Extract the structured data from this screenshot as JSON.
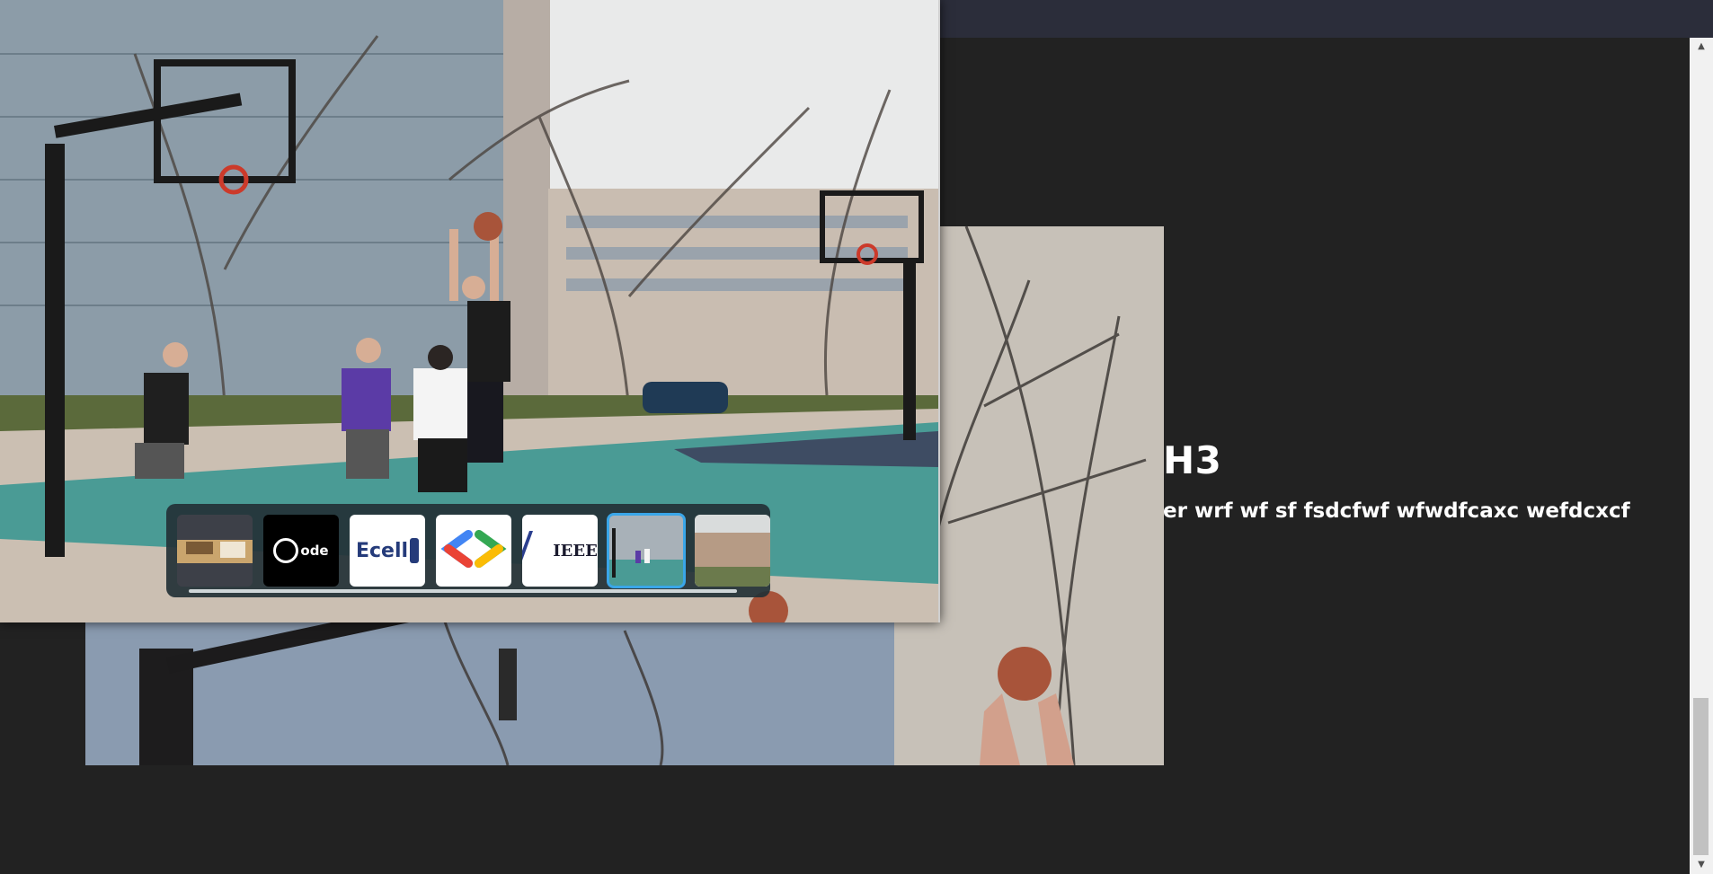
{
  "section": {
    "title": "H3",
    "text": "er wrf wf sf fsdcfwf wfwdfcaxc wefdcxcf"
  },
  "gallery": {
    "thumbnails": [
      {
        "name": "workspace",
        "label": ""
      },
      {
        "name": "code-club",
        "label": "ode"
      },
      {
        "name": "ecell",
        "label": "Ecell"
      },
      {
        "name": "gdsc",
        "label": ""
      },
      {
        "name": "ieee",
        "label": "IEEE"
      },
      {
        "name": "basketball",
        "label": ""
      },
      {
        "name": "campus",
        "label": ""
      }
    ],
    "active_index": 5
  },
  "colors": {
    "page_bg": "#222222",
    "topbar_bg": "#2b2d3a",
    "active_thumb_border": "#3aa6e8",
    "court": "#4a9b95"
  }
}
